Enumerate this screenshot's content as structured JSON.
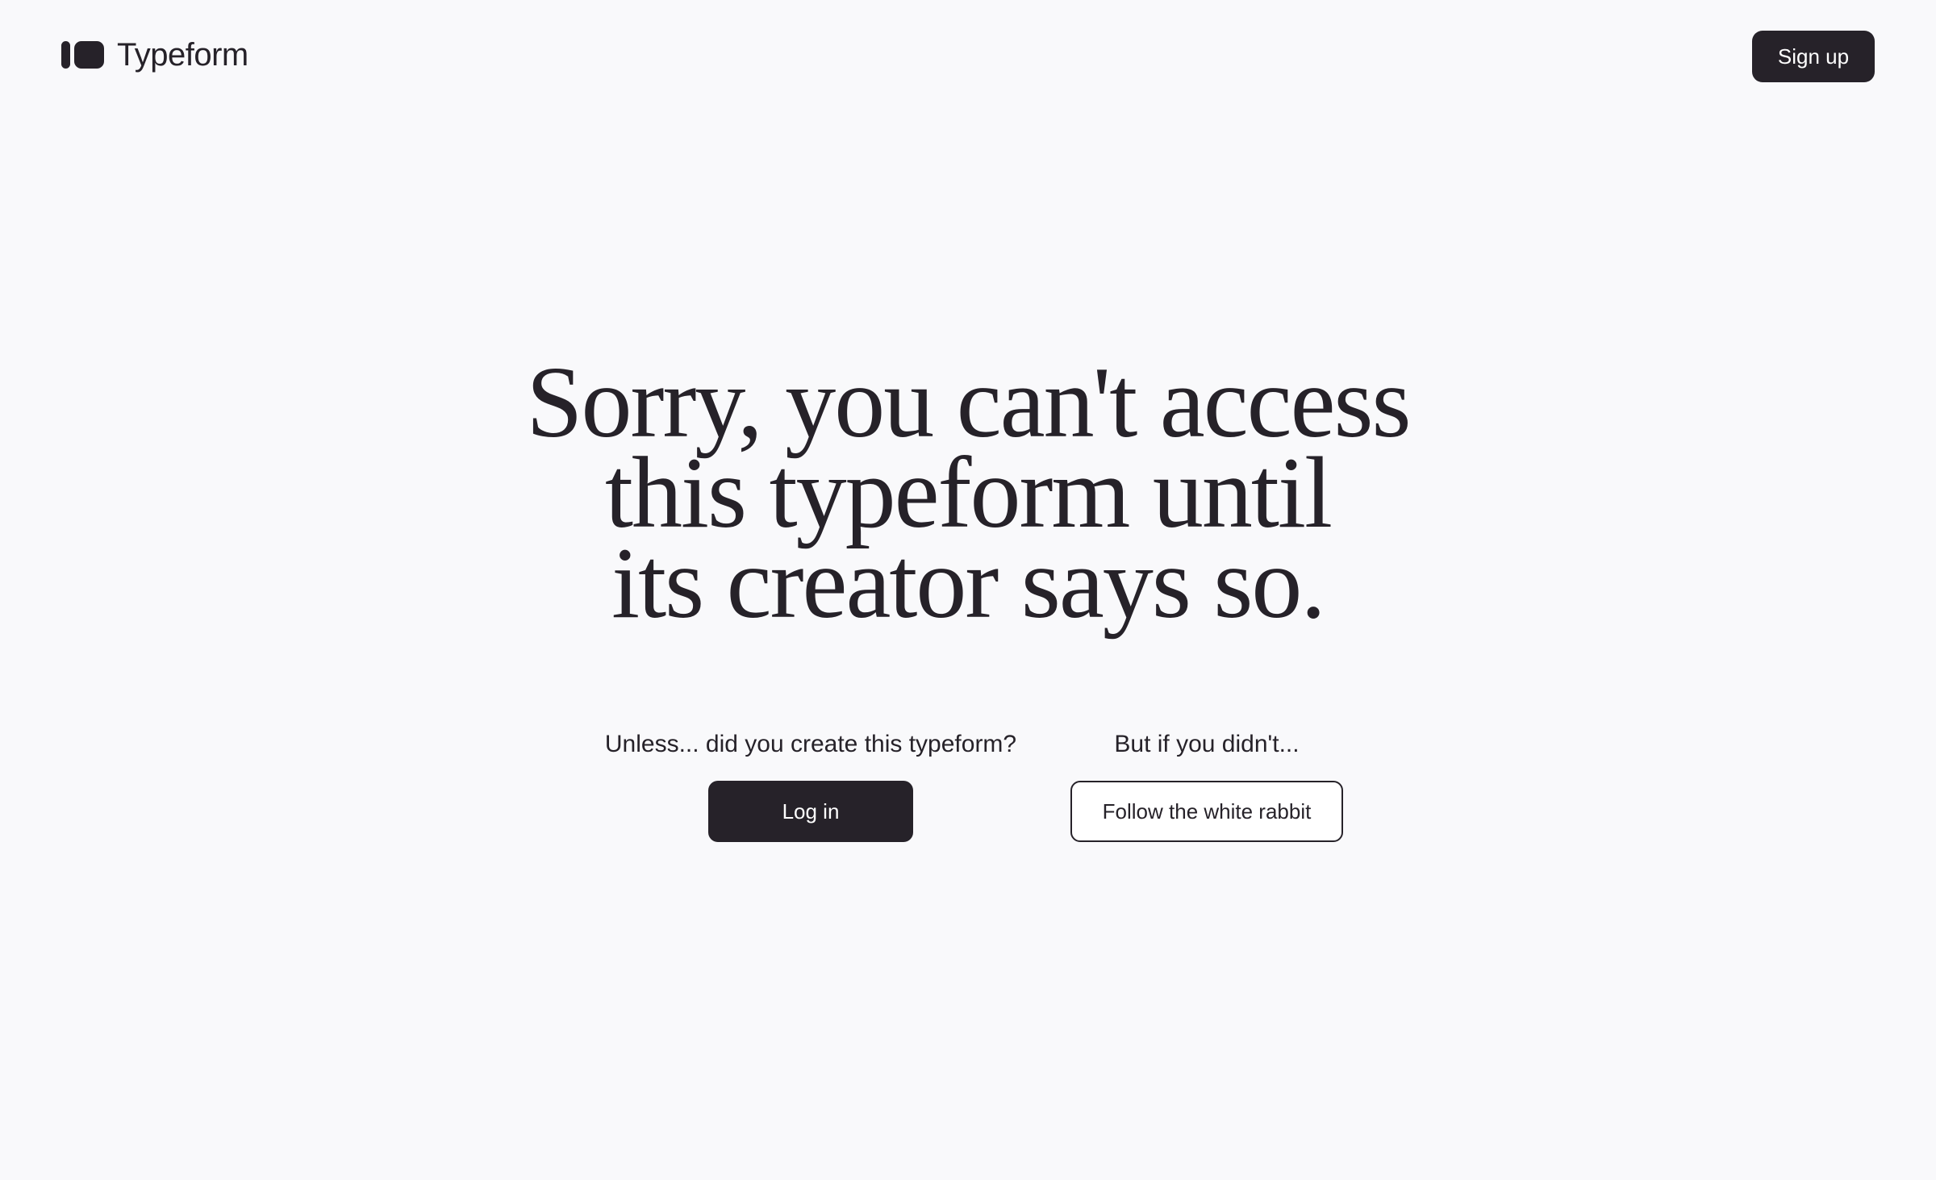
{
  "header": {
    "brand_name": "Typeform",
    "signup_label": "Sign up"
  },
  "main": {
    "headline_lines": [
      "Sorry, you can't access",
      "this typeform until",
      "its creator says so."
    ],
    "creator_prompt": "Unless... did you create this typeform?",
    "login_label": "Log in",
    "visitor_prompt": "But if you didn't...",
    "rabbit_label": "Follow the white rabbit"
  },
  "colors": {
    "background": "#f9f9fb",
    "ink": "#262229",
    "button_text": "#ffffff"
  },
  "icons": {
    "logo": "typeform-logo-icon"
  }
}
